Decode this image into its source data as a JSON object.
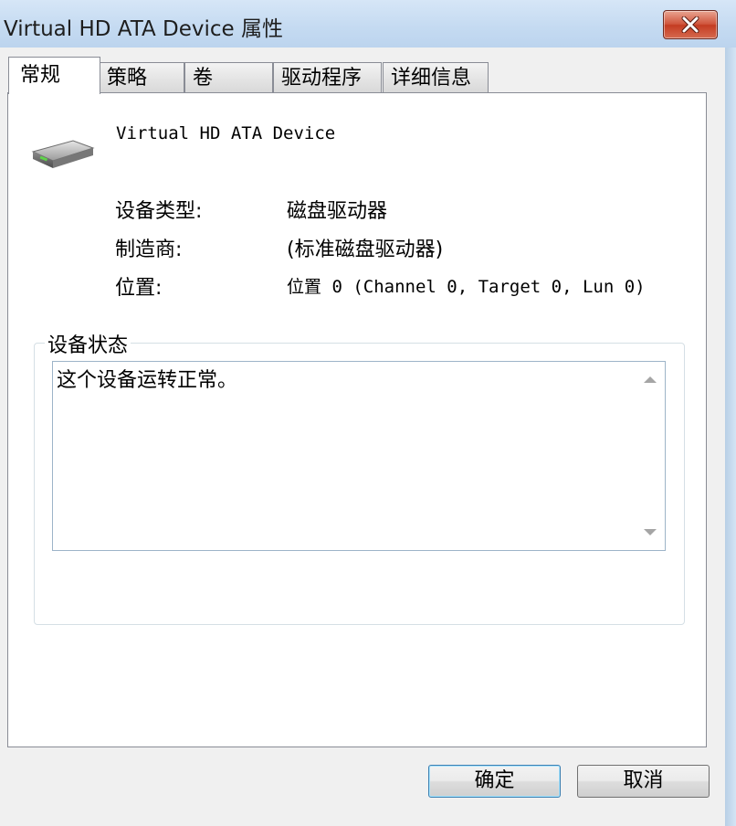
{
  "window": {
    "title": "Virtual HD ATA Device 属性"
  },
  "tabs": [
    {
      "label": "常规",
      "active": true
    },
    {
      "label": "策略",
      "active": false
    },
    {
      "label": "卷",
      "active": false
    },
    {
      "label": "驱动程序",
      "active": false
    },
    {
      "label": "详细信息",
      "active": false
    }
  ],
  "device": {
    "name": "Virtual HD ATA Device",
    "icon": "hard-disk-icon"
  },
  "properties": {
    "type_label": "设备类型:",
    "type_value": "磁盘驱动器",
    "manufacturer_label": "制造商:",
    "manufacturer_value": "(标准磁盘驱动器)",
    "location_label": "位置:",
    "location_value": "位置 0 (Channel 0, Target 0, Lun 0)"
  },
  "status": {
    "group_label": "设备状态",
    "text": "这个设备运转正常。"
  },
  "buttons": {
    "ok": "确定",
    "cancel": "取消"
  },
  "colors": {
    "close_button": "#c43c22",
    "titlebar": "#c4daf1",
    "dialog_bg": "#f0f0f0"
  }
}
